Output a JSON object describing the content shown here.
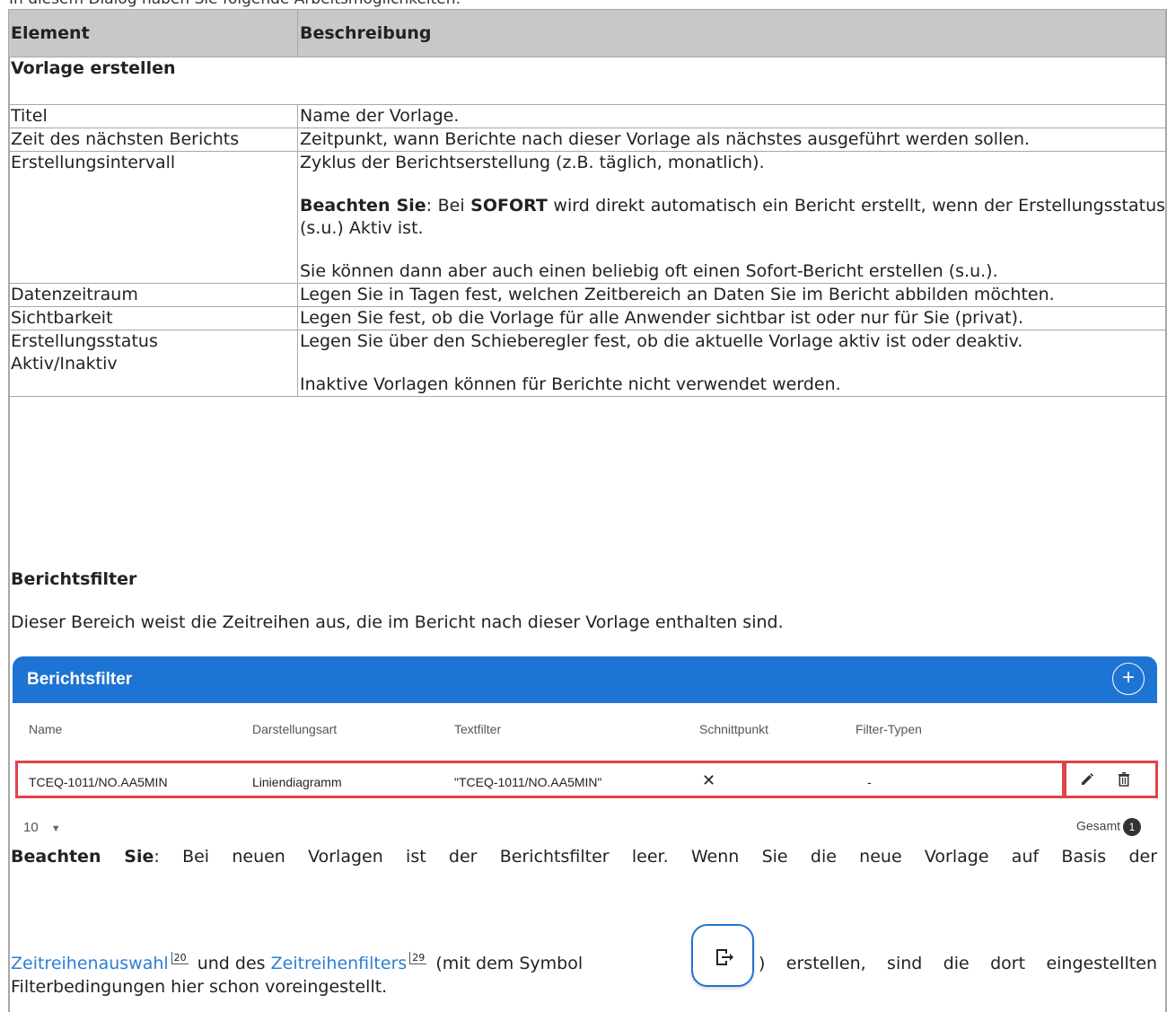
{
  "intro_text": "In diesem Dialog haben Sie folgende Arbeitsmöglichkeiten:",
  "table": {
    "headers": {
      "element": "Element",
      "description": "Beschreibung"
    },
    "section_create": "Vorlage erstellen",
    "rows": [
      {
        "element": "Titel",
        "desc": [
          "Name der Vorlage."
        ]
      },
      {
        "element": "Zeit des nächsten Berichts",
        "desc": [
          "Zeitpunkt, wann Berichte nach dieser Vorlage als nächstes ausgeführt werden sollen."
        ]
      },
      {
        "element": "Erstellungsintervall",
        "desc": [
          "Zyklus der Berichtserstellung (z.B. täglich, monatlich).",
          "Sie können dann aber auch einen beliebig oft einen Sofort-Bericht erstellen (s.u.)."
        ],
        "note": {
          "label": "Beachten Sie",
          "pre": ": Bei ",
          "keyword": "SOFORT",
          "post": " wird direkt automatisch ein Bericht erstellt, wenn der Erstellungsstatus (s.u.) Aktiv ist."
        }
      },
      {
        "element": "Datenzeitraum",
        "desc": [
          "Legen Sie in Tagen fest, welchen Zeitbereich an Daten Sie im Bericht abbilden möchten."
        ]
      },
      {
        "element": "Sichtbarkeit",
        "desc": [
          "Legen Sie fest, ob die Vorlage für alle Anwender sichtbar ist oder nur für Sie (privat)."
        ]
      },
      {
        "element": "Erstellungsstatus Aktiv/Inaktiv",
        "desc": [
          "Legen Sie über den Schieberegler fest, ob die aktuelle Vorlage aktiv ist oder deaktiv.",
          "Inaktive Vorlagen können für Berichte nicht verwendet werden."
        ]
      }
    ]
  },
  "filter_section": {
    "title": "Berichtsfilter",
    "description": "Dieser Bereich weist die Zeitreihen aus, die im Bericht nach dieser Vorlage enthalten sind."
  },
  "widget": {
    "title": "Berichtsfilter",
    "add_symbol": "+",
    "columns": [
      "Name",
      "Darstellungsart",
      "Textfilter",
      "Schnittpunkt",
      "Filter-Typen"
    ],
    "row": {
      "name": "TCEQ-1011/NO.AA5MIN",
      "darstellungsart": "Liniendiagramm",
      "textfilter": "\"TCEQ-1011/NO.AA5MIN\"",
      "schnittpunkt": "✕",
      "filter_typen": "-"
    },
    "page_size": "10",
    "total_label": "Gesamt",
    "total_count": "1",
    "highlight_color": "#e0424a",
    "header_color": "#1e74d2"
  },
  "note": {
    "label": "Beachten Sie",
    "line1": ": Bei neuen Vorlagen ist der Berichtsfilter leer. Wenn Sie die neue Vorlage auf Basis der",
    "link1": "Zeitreihenauswahl",
    "ref1": "20",
    "mid": "und des",
    "link2": "Zeitreihenfilters",
    "ref2": "29",
    "symbol_text": "(mit dem Symbol",
    "after_symbol": ") erstellen, sind die dort eingestellten",
    "line3": "Filterbedingungen hier schon voreingestellt."
  }
}
